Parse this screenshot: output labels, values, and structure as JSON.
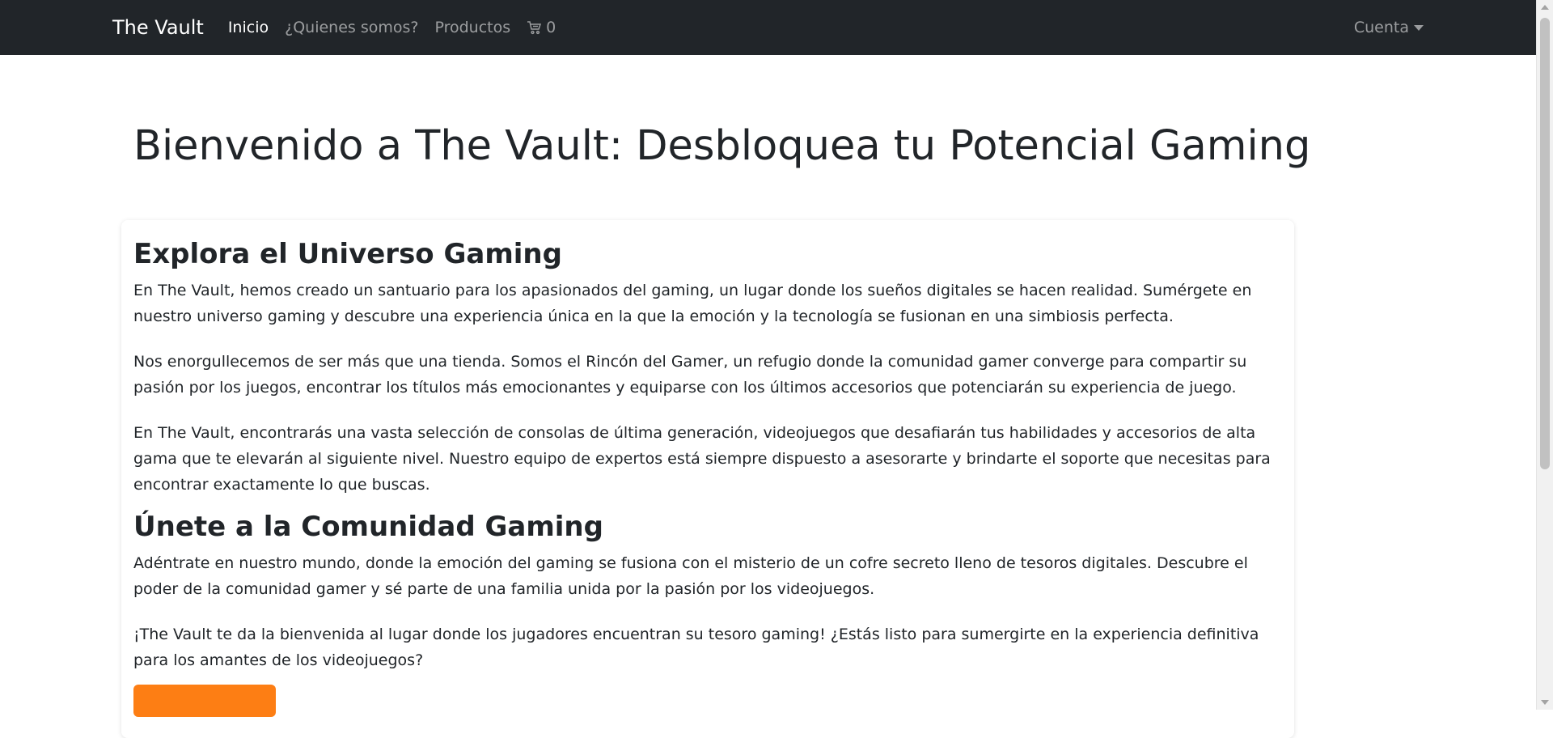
{
  "navbar": {
    "brand": "The Vault",
    "links": [
      "Inicio",
      "¿Quienes somos?",
      "Productos"
    ],
    "cart_count": "0",
    "cart_icon": "cart-icon",
    "account_label": "Cuenta"
  },
  "hero": {
    "title": "Bienvenido a The Vault: Desbloquea tu Potencial Gaming"
  },
  "sections": [
    {
      "heading": "Explora el Universo Gaming",
      "paragraphs": [
        "En The Vault, hemos creado un santuario para los apasionados del gaming, un lugar donde los sueños digitales se hacen realidad. Sumérgete en nuestro universo gaming y descubre una experiencia única en la que la emoción y la tecnología se fusionan en una simbiosis perfecta.",
        "Nos enorgullecemos de ser más que una tienda. Somos el Rincón del Gamer, un refugio donde la comunidad gamer converge para compartir su pasión por los juegos, encontrar los títulos más emocionantes y equiparse con los últimos accesorios que potenciarán su experiencia de juego.",
        "En The Vault, encontrarás una vasta selección de consolas de última generación, videojuegos que desafiarán tus habilidades y accesorios de alta gama que te elevarán al siguiente nivel. Nuestro equipo de expertos está siempre dispuesto a asesorarte y brindarte el soporte que necesitas para encontrar exactamente lo que buscas."
      ]
    },
    {
      "heading": "Únete a la Comunidad Gaming",
      "paragraphs": [
        "Adéntrate en nuestro mundo, donde la emoción del gaming se fusiona con el misterio de un cofre secreto lleno de tesoros digitales. Descubre el poder de la comunidad gamer y sé parte de una familia unida por la pasión por los videojuegos.",
        "¡The Vault te da la bienvenida al lugar donde los jugadores encuentran su tesoro gaming! ¿Estás listo para sumergirte en la experiencia definitiva para los amantes de los videojuegos?"
      ]
    }
  ],
  "colors": {
    "navbar": "#212529",
    "accent": "#fd7e14",
    "text": "#212529"
  }
}
